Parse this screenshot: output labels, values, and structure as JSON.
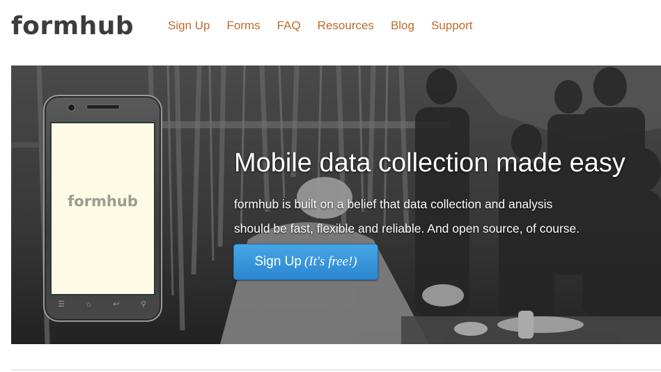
{
  "header": {
    "logo": "formhub",
    "nav": [
      {
        "label": "Sign Up"
      },
      {
        "label": "Forms"
      },
      {
        "label": "FAQ"
      },
      {
        "label": "Resources"
      },
      {
        "label": "Blog"
      },
      {
        "label": "Support"
      }
    ]
  },
  "hero": {
    "phone_screen_label": "formhub",
    "title": "Mobile data collection made easy",
    "description_line1": "formhub is built on a belief that data collection and analysis",
    "description_line2": "should be fast, flexible and reliable. And open source, of course.",
    "cta_label": "Sign Up",
    "cta_emphasis": "(It's free!)"
  },
  "colors": {
    "logo": "#3c3c3c",
    "nav_link": "#c06a2b",
    "cta_top": "#46a6e6",
    "cta_bottom": "#2c86cf",
    "phone_screen": "#fdfbe6"
  },
  "icons": {
    "phone_buttons": [
      "menu-icon",
      "home-icon",
      "back-icon",
      "search-icon"
    ]
  }
}
